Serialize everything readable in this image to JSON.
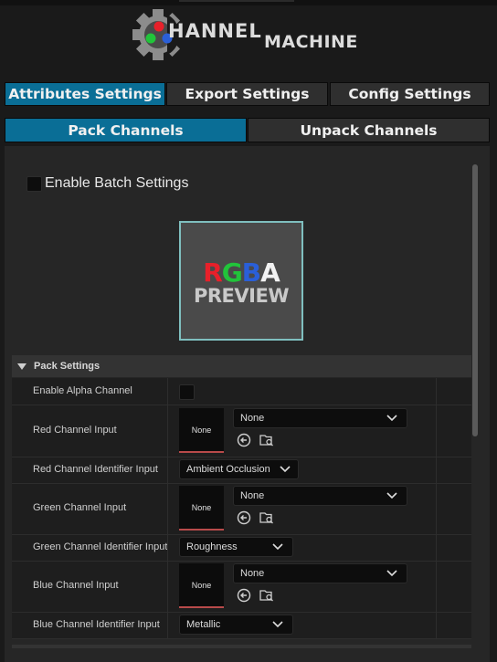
{
  "logo": {
    "text_channel": "HANNEL",
    "text_machine": "MACHINE"
  },
  "tabs_top": [
    {
      "label": "Attributes Settings",
      "active": true
    },
    {
      "label": "Export Settings",
      "active": false
    },
    {
      "label": "Config Settings",
      "active": false
    }
  ],
  "tabs_sub": [
    {
      "label": "Pack Channels",
      "active": true
    },
    {
      "label": "Unpack Channels",
      "active": false
    }
  ],
  "batch": {
    "label": "Enable Batch Settings",
    "checked": false
  },
  "preview": {
    "r": "R",
    "g": "G",
    "b": "B",
    "a": "A",
    "word": "PREVIEW"
  },
  "pack_settings": {
    "title": "Pack Settings",
    "enable_alpha_label": "Enable Alpha Channel",
    "red_input_label": "Red Channel Input",
    "red_thumb": "None",
    "red_asset": "None",
    "red_id_label": "Red Channel Identifier Input",
    "red_id_value": "Ambient Occlusion",
    "green_input_label": "Green Channel Input",
    "green_thumb": "None",
    "green_asset": "None",
    "green_id_label": "Green Channel Identifier Input",
    "green_id_value": "Roughness",
    "blue_input_label": "Blue Channel Input",
    "blue_thumb": "None",
    "blue_asset": "None",
    "blue_id_label": "Blue Channel Identifier Input",
    "blue_id_value": "Metallic"
  },
  "colors": {
    "accent": "#0a6e96",
    "red": "#e8202a",
    "green": "#21c43a",
    "blue": "#2a5fd8"
  }
}
